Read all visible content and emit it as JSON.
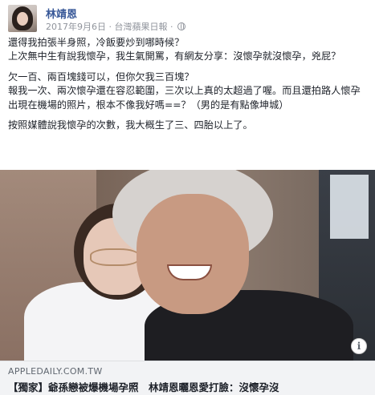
{
  "post": {
    "author": "林靖恩",
    "date": "2017年9月6日",
    "separator": "·",
    "location": "台灣蘋果日報",
    "privacy_icon": "globe-icon",
    "lines": [
      "還得我拍張半身照，冷飯要炒到哪時候？",
      "上次無中生有說我懷孕，我生氣開罵，有網友分享：沒懷孕就沒懷孕，兇屁？",
      "欠一百、兩百塊錢可以，但你欠我三百塊？",
      "報我一次、兩次懷孕還在容忍範圍，三次以上真的太超過了喔。而且還拍路人懷孕出現在機場的照片，根本不像我好嗎==？（男的是有點像坤城）",
      "按照媒體說我懷孕的次數，我大概生了三、四胎以上了。"
    ]
  },
  "link_preview": {
    "domain": "APPLEDAILY.COM.TW",
    "title": "【獨家】爺孫戀被爆機場孕照　林靖恩曬恩愛打臉：沒懷孕沒",
    "info_icon": "info-icon",
    "info_glyph": "i"
  }
}
